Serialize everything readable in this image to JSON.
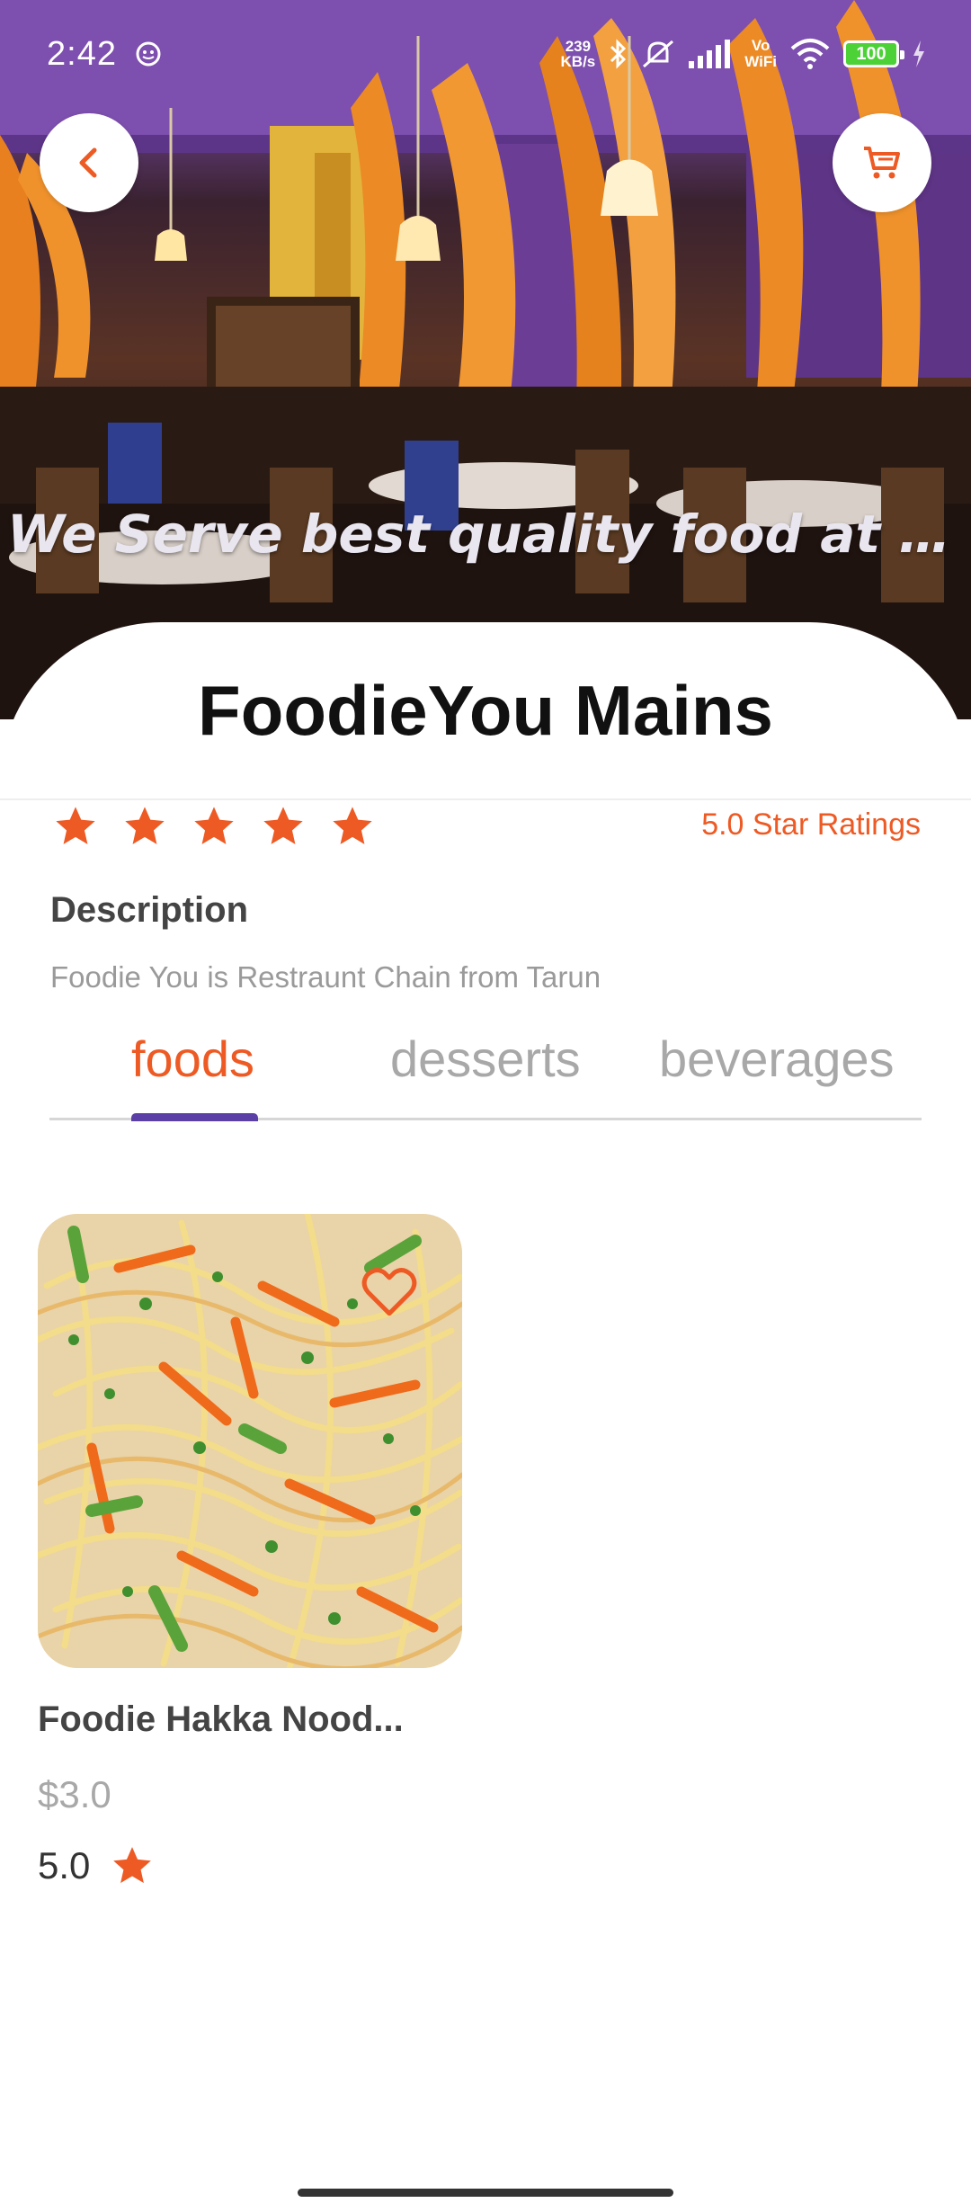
{
  "status_bar": {
    "time": "2:42",
    "net_speed_value": "239",
    "net_speed_unit": "KB/s",
    "volte_top": "Vo",
    "volte_bottom": "WiFi",
    "battery": "100"
  },
  "hero": {
    "tagline": "We Serve best quality food at m..."
  },
  "restaurant": {
    "name": "FoodieYou Mains",
    "rating_value": 5,
    "rating_text": "5.0 Star Ratings",
    "description_label": "Description",
    "description": "Foodie You is Restraunt Chain from Tarun"
  },
  "tabs": [
    {
      "label": "foods",
      "active": true
    },
    {
      "label": "desserts",
      "active": false
    },
    {
      "label": "beverages",
      "active": false
    }
  ],
  "foods": [
    {
      "name": "Foodie Hakka Nood...",
      "price": "$3.0",
      "rating": "5.0",
      "favorite": false
    }
  ],
  "colors": {
    "accent": "#ee5a24",
    "tab_indicator": "#5b3fa6",
    "title": "#111111",
    "muted": "#a8a8a8"
  },
  "icons": {
    "back": "chevron-left-icon",
    "cart": "cart-icon",
    "star": "star-icon",
    "favorite": "heart-outline-icon"
  }
}
